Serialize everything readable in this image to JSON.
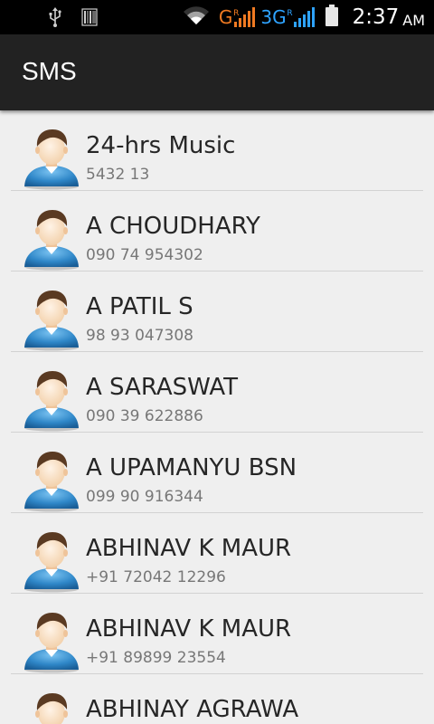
{
  "status_bar": {
    "network_g": "G",
    "network_g_roaming": "R",
    "network_3g": "3G",
    "network_3g_roaming": "R",
    "time": "2:37",
    "ampm": "AM",
    "icons": [
      "usb-icon",
      "barcode-icon",
      "wifi-icon",
      "signal-icon",
      "signal-icon",
      "battery-icon"
    ]
  },
  "action_bar": {
    "title": "SMS"
  },
  "contacts": [
    {
      "name": "24-hrs Music",
      "phone": "5432 13"
    },
    {
      "name": "A CHOUDHARY",
      "phone": "090 74 954302"
    },
    {
      "name": "A PATIL S",
      "phone": "98 93 047308"
    },
    {
      "name": "A SARASWAT",
      "phone": "090 39 622886"
    },
    {
      "name": "A UPAMANYU BSN",
      "phone": "099 90 916344"
    },
    {
      "name": "ABHINAV K MAUR",
      "phone": "+91 72042 12296"
    },
    {
      "name": "ABHINAV K MAUR",
      "phone": "+91 89899 23554"
    },
    {
      "name": "ABHINAY AGRAWA",
      "phone": ""
    }
  ],
  "colors": {
    "status_bar": "#000000",
    "action_bar": "#222222",
    "background": "#efefef",
    "network_g": "#f07a22",
    "network_3g": "#2ea3ff",
    "avatar_shirt": "#2f87c8",
    "avatar_hair": "#5a3a22"
  }
}
